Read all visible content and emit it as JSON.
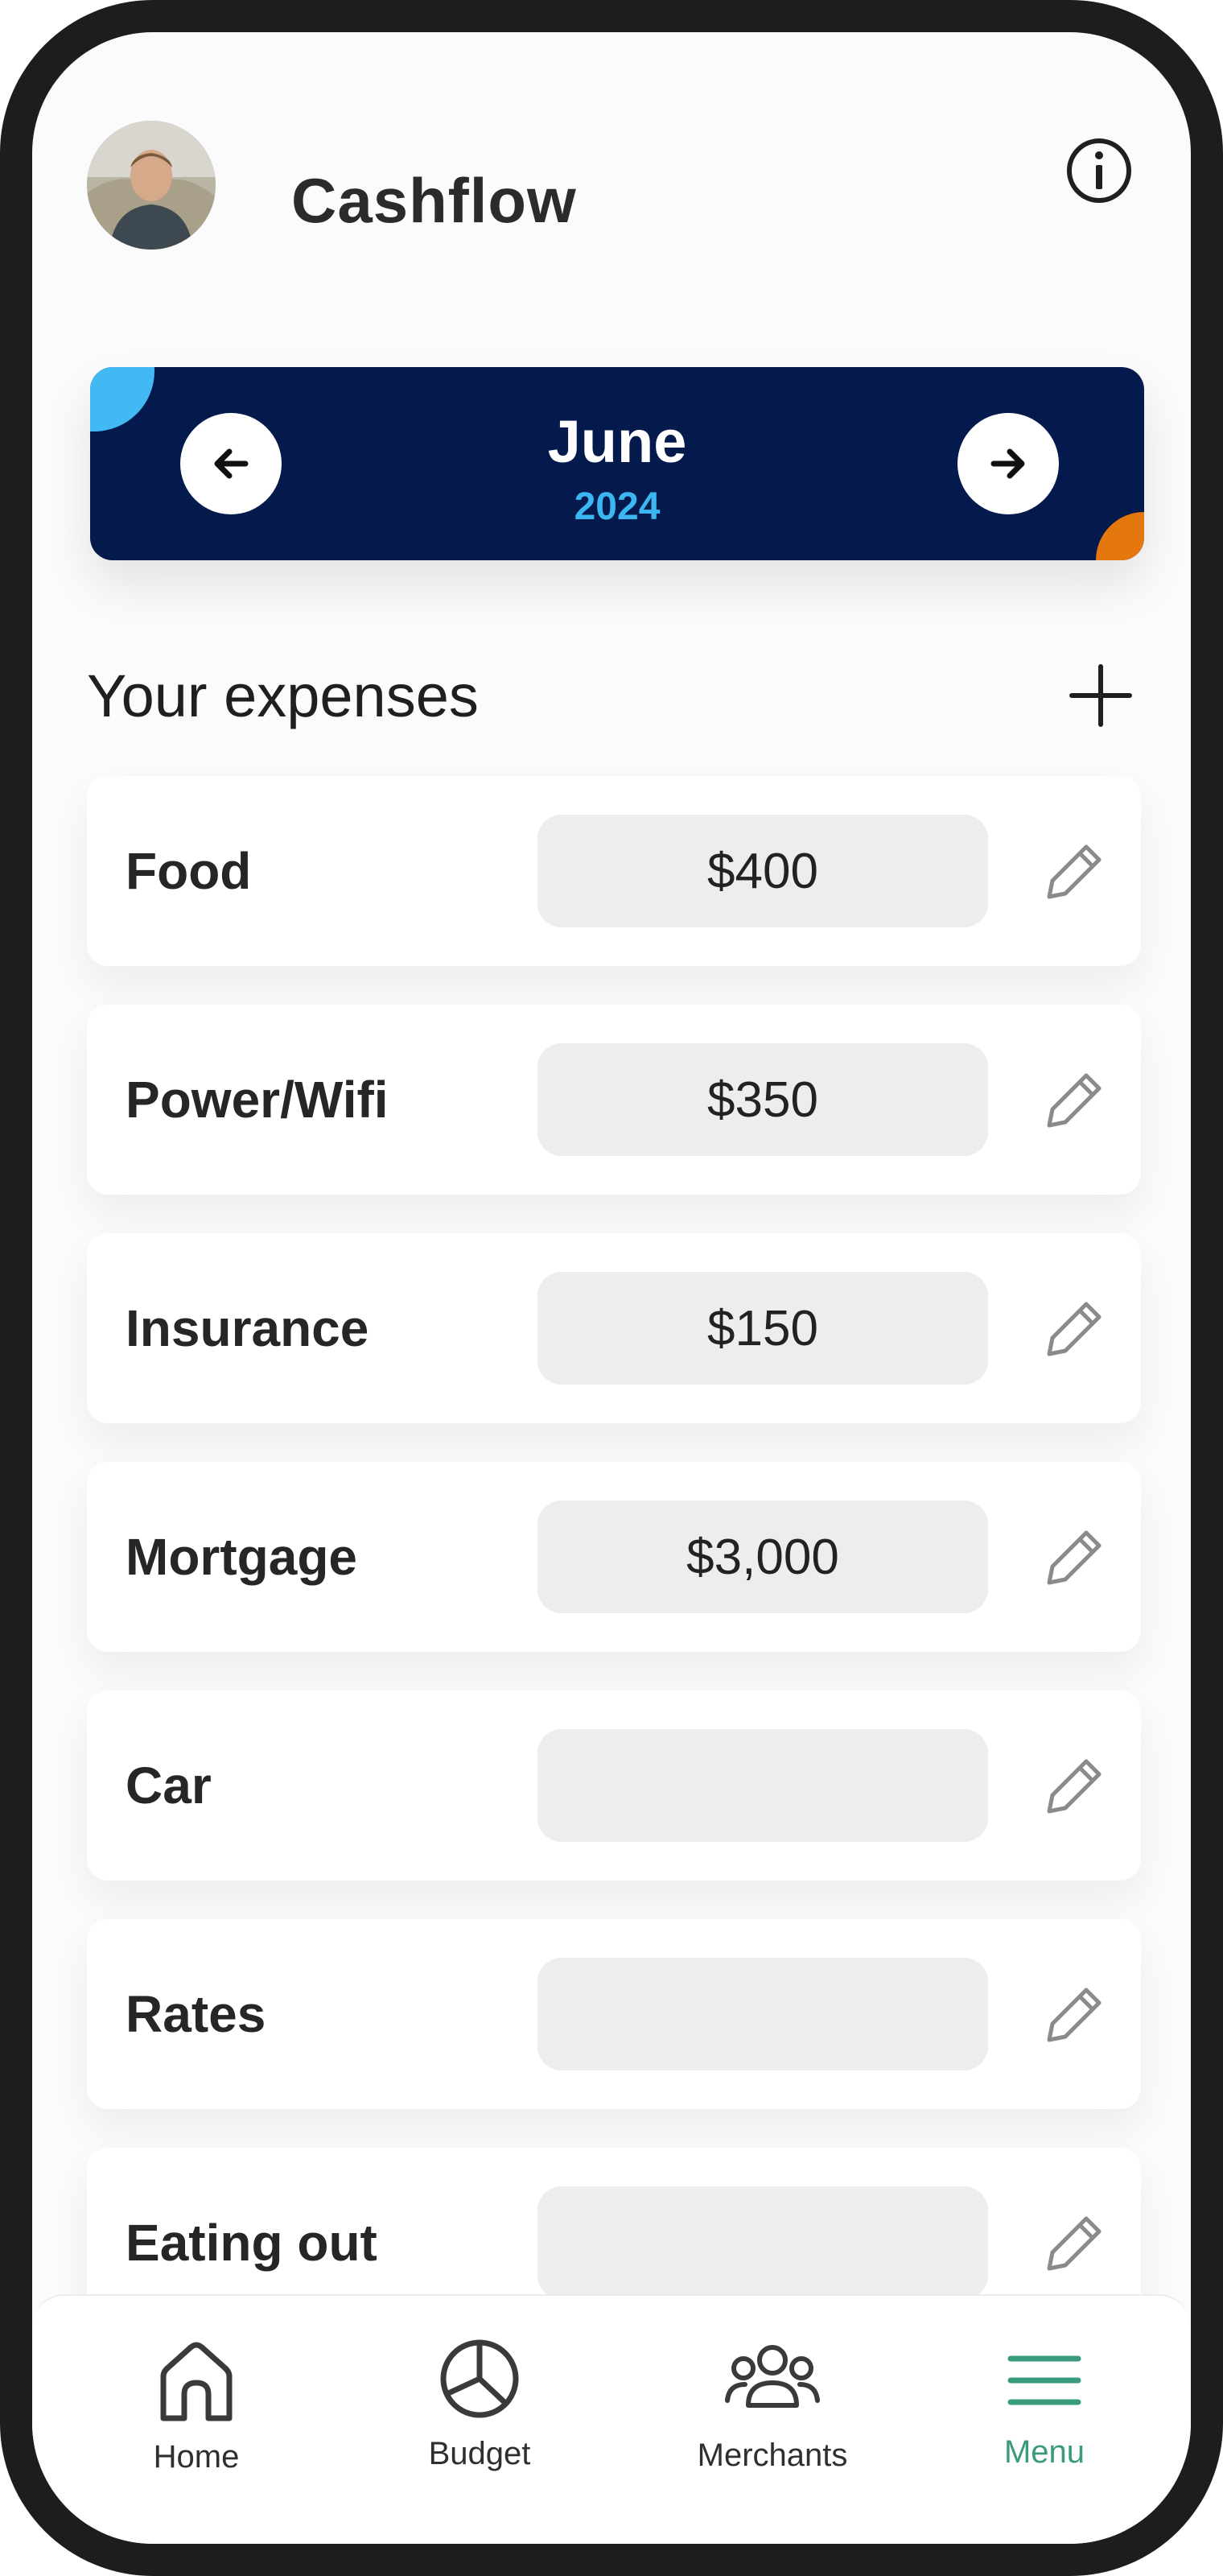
{
  "header": {
    "title": "Cashflow",
    "avatar_icon": "user-avatar-photo",
    "info_icon": "info-icon"
  },
  "month_selector": {
    "month": "June",
    "year": "2024",
    "prev_icon": "arrow-left-icon",
    "next_icon": "arrow-right-icon",
    "colors": {
      "banner": "#041a4d",
      "year": "#3bb6f0",
      "accent_blue": "#42b8f5",
      "accent_orange": "#e4780e"
    }
  },
  "expenses": {
    "title": "Your expenses",
    "add_icon": "plus-icon",
    "items": [
      {
        "name": "Food",
        "amount": "$400"
      },
      {
        "name": "Power/Wifi",
        "amount": "$350"
      },
      {
        "name": "Insurance",
        "amount": "$150"
      },
      {
        "name": "Mortgage",
        "amount": "$3,000"
      },
      {
        "name": "Car",
        "amount": ""
      },
      {
        "name": "Rates",
        "amount": ""
      },
      {
        "name": "Eating out",
        "amount": ""
      }
    ]
  },
  "bottom_nav": {
    "items": [
      {
        "label": "Home",
        "icon": "home-icon",
        "active": false
      },
      {
        "label": "Budget",
        "icon": "pie-chart-icon",
        "active": false
      },
      {
        "label": "Merchants",
        "icon": "users-icon",
        "active": false
      },
      {
        "label": "Menu",
        "icon": "menu-icon",
        "active": true
      }
    ],
    "active_color": "#3a9a7e"
  }
}
